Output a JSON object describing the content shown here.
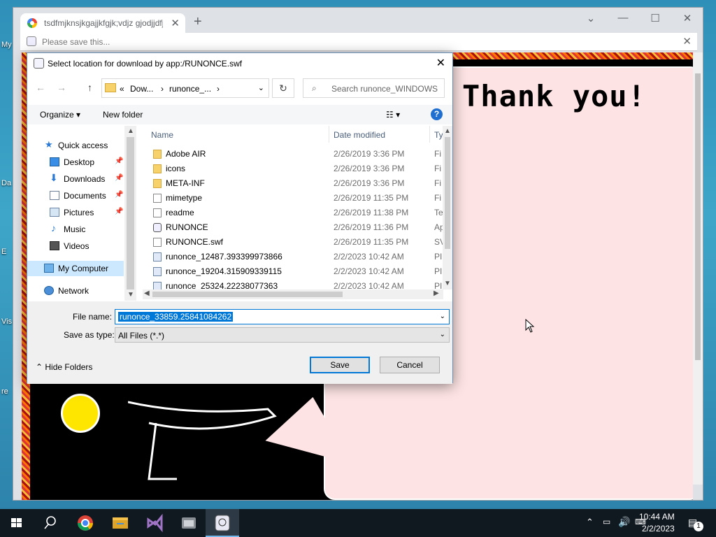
{
  "desktop": {
    "fragments": [
      "My",
      "Da",
      "E",
      "Vis",
      "re"
    ]
  },
  "browser": {
    "tab_title": "tsdfmjknsjkgajjkfgjk;vdjz gjodjjdfjdfj",
    "new_tab_symbol": "+",
    "controls": {
      "dropdown": "⌄",
      "minimize": "—",
      "maximize": "☐",
      "close": "✕"
    },
    "infobar_text": "Please save this...",
    "infobar_close": "✕"
  },
  "flash": {
    "headline": "Thank you!"
  },
  "dialog": {
    "title": "Select location for download by app:/RUNONCE.swf",
    "close": "✕",
    "address": {
      "prefix": "«",
      "crumb1": "Dow...",
      "sep1": "›",
      "crumb2": "runonce_...",
      "sep2": "›",
      "dropdown": "⌄"
    },
    "refresh_symbol": "↻",
    "search_placeholder": "Search runonce_WINDOWS",
    "toolbar": {
      "organize": "Organize ▾",
      "new_folder": "New folder",
      "view": "☷ ▾",
      "help": "?"
    },
    "nav": [
      {
        "label": "Quick access",
        "icon": "star-icon",
        "pinned": false
      },
      {
        "label": "Desktop",
        "icon": "desktop-icon",
        "pinned": true
      },
      {
        "label": "Downloads",
        "icon": "download-icon",
        "pinned": true
      },
      {
        "label": "Documents",
        "icon": "documents-icon",
        "pinned": true
      },
      {
        "label": "Pictures",
        "icon": "pictures-icon",
        "pinned": true
      },
      {
        "label": "Music",
        "icon": "music-icon",
        "pinned": false
      },
      {
        "label": "Videos",
        "icon": "videos-icon",
        "pinned": false
      },
      {
        "label": "My Computer",
        "icon": "computer-icon",
        "pinned": false
      },
      {
        "label": "Network",
        "icon": "network-icon",
        "pinned": false
      }
    ],
    "columns": {
      "name": "Name",
      "date": "Date modified",
      "type": "Ty"
    },
    "files": [
      {
        "name": "Adobe AIR",
        "date": "2/26/2019 3:36 PM",
        "type": "Fi",
        "icon": "folder"
      },
      {
        "name": "icons",
        "date": "2/26/2019 3:36 PM",
        "type": "Fi",
        "icon": "folder"
      },
      {
        "name": "META-INF",
        "date": "2/26/2019 3:36 PM",
        "type": "Fi",
        "icon": "folder"
      },
      {
        "name": "mimetype",
        "date": "2/26/2019 11:35 PM",
        "type": "Fi",
        "icon": "file"
      },
      {
        "name": "readme",
        "date": "2/26/2019 11:38 PM",
        "type": "Te",
        "icon": "file"
      },
      {
        "name": "RUNONCE",
        "date": "2/26/2019 11:36 PM",
        "type": "Ap",
        "icon": "app"
      },
      {
        "name": "RUNONCE.swf",
        "date": "2/26/2019 11:35 PM",
        "type": "SV",
        "icon": "file"
      },
      {
        "name": "runonce_12487.393399973866",
        "date": "2/2/2023 10:42 AM",
        "type": "PI",
        "icon": "img"
      },
      {
        "name": "runonce_19204.315909339115",
        "date": "2/2/2023 10:42 AM",
        "type": "PI",
        "icon": "img"
      },
      {
        "name": "runonce_25324.22238077363",
        "date": "2/2/2023 10:42 AM",
        "type": "PI",
        "icon": "img"
      }
    ],
    "file_name_label": "File name:",
    "file_name_value": "runonce_33859.25841084262",
    "save_type_label": "Save as type:",
    "save_type_value": "All Files (*.*)",
    "hide_folders": "Hide Folders",
    "save": "Save",
    "cancel": "Cancel"
  },
  "taskbar": {
    "time": "10:44 AM",
    "date": "2/2/2023",
    "notification_count": "1"
  }
}
